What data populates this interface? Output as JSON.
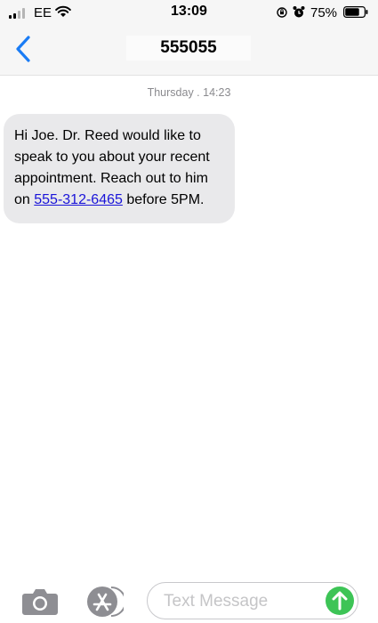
{
  "status_bar": {
    "carrier": "EE",
    "time": "13:09",
    "battery_percent": "75%",
    "battery_level": 0.75,
    "icons": [
      "signal-icon",
      "wifi-icon",
      "orientation-lock-icon",
      "alarm-icon",
      "battery-icon"
    ]
  },
  "header": {
    "contact": "555055",
    "back_icon": "chevron-left-icon"
  },
  "thread": {
    "timestamp": "Thursday . 14:23",
    "messages": [
      {
        "direction": "incoming",
        "text_before": "Hi Joe. Dr. Reed would like to speak to you about your recent appointment. Reach out to him on ",
        "link": "555-312-6465",
        "text_after": " before 5PM."
      }
    ]
  },
  "composer": {
    "placeholder": "Text Message",
    "icons": [
      "camera-icon",
      "app-store-icon",
      "send-arrow-icon"
    ]
  },
  "colors": {
    "accent": "#1a7cf5",
    "bubble_incoming": "#e9e9eb",
    "link": "#1a14d9",
    "send": "#3dc456"
  }
}
